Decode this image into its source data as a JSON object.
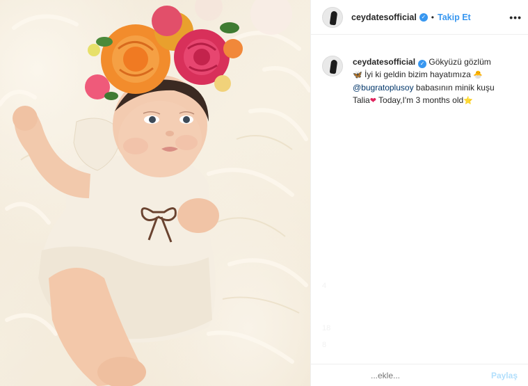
{
  "post": {
    "username": "ceydatesofficial",
    "follow_label": "Takip Et",
    "separator": "•",
    "more_label": "•••",
    "verified_glyph": "✓"
  },
  "caption": {
    "username": "ceydatesofficial",
    "line1": "Gökyüzü gözlüm",
    "line2": "İyi ki geldin bizim hayatımıza",
    "mention": "@bugratoplusoy",
    "line3": "babasının minik kuşu",
    "line4a": "Talia",
    "line4b": "Today,I'm 3 months old",
    "emoji_butterfly": "🦋",
    "emoji_chick": "🐣",
    "emoji_heart": "❤",
    "emoji_star": "⭐"
  },
  "faint": {
    "n1": "4",
    "n2": "18",
    "n3": "8"
  },
  "comment": {
    "placeholder": "...ekle...",
    "post_label": "Paylaş"
  },
  "colors": {
    "accent": "#3897f0",
    "mention": "#003569",
    "divider": "#efefef"
  },
  "icons": [
    "verified-badge-icon",
    "more-options-icon"
  ]
}
